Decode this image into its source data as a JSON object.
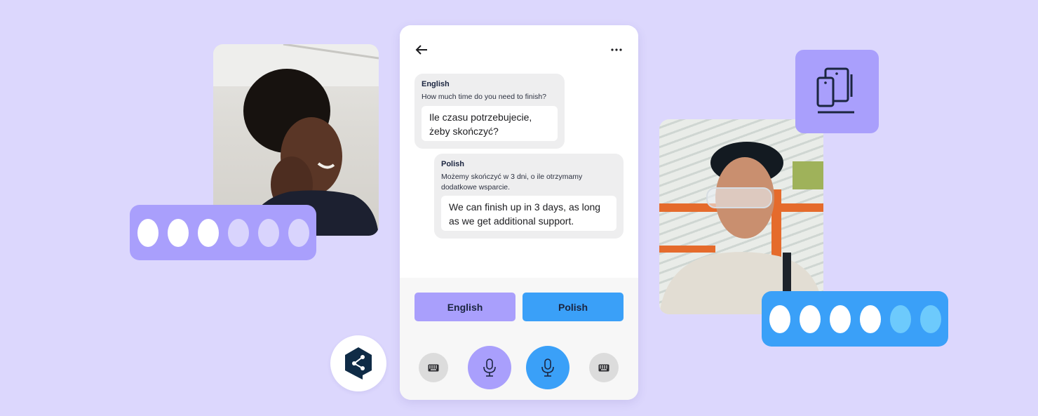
{
  "colors": {
    "background": "#dcd7fd",
    "accent_purple": "#a99ffc",
    "accent_blue": "#3aa0f8",
    "dot_active": "#ffffff",
    "dot_inactive_purple": "#d9d4fd",
    "dot_inactive_blue": "#6dcafc",
    "text_dark": "#1b2540"
  },
  "left_speaker": {
    "photo_alt": "Smiling woman with curly hair",
    "indicator": {
      "total": 6,
      "active": 3
    }
  },
  "right_speaker": {
    "photo_alt": "Young man wearing safety glasses",
    "indicator": {
      "total": 6,
      "active": 4
    }
  },
  "decorations": {
    "device_icon": "devices-icon",
    "logo_icon": "deepl-logo-icon"
  },
  "phone": {
    "header": {
      "back_icon": "arrow-left-icon",
      "menu_icon": "more-horizontal-icon"
    },
    "messages": [
      {
        "language": "English",
        "source": "How much time do you need to finish?",
        "translation": "Ile czasu potrzebujecie, żeby skończyć?"
      },
      {
        "language": "Polish",
        "source": "Możemy skończyć w 3 dni, o ile otrzymamy dodatkowe wsparcie.",
        "translation": "We can finish up in 3 days, as long as we get additional support."
      }
    ],
    "language_buttons": {
      "english": "English",
      "polish": "Polish"
    },
    "controls": [
      {
        "name": "keyboard-left",
        "icon": "keyboard-icon"
      },
      {
        "name": "mic-english",
        "icon": "microphone-icon"
      },
      {
        "name": "mic-polish",
        "icon": "microphone-icon"
      },
      {
        "name": "keyboard-right",
        "icon": "keyboard-icon"
      }
    ]
  }
}
